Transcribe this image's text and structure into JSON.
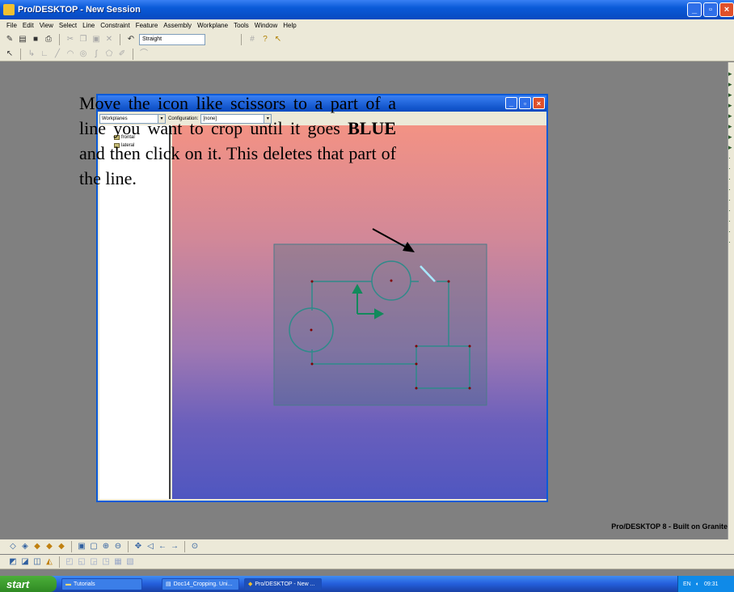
{
  "window": {
    "title": "Pro/DESKTOP - New Session"
  },
  "menu": [
    "File",
    "Edit",
    "View",
    "Select",
    "Line",
    "Constraint",
    "Feature",
    "Assembly",
    "Workplane",
    "Tools",
    "Window",
    "Help"
  ],
  "toolbar": {
    "line_style_value": "Straight"
  },
  "browser": {
    "workplanes_select": "Workplanes",
    "configuration_label": "Configuration:",
    "configuration_value": "[none]",
    "tree_items": [
      "frontal",
      "lateral"
    ]
  },
  "note": {
    "part1": "Move the icon like scissors to a part of a line you want to crop until it goes ",
    "bold": "BLUE",
    "part2": " and then click on it. This deletes that part of the line."
  },
  "status": {
    "product_label": "Pro/DESKTOP 8 - Built on Granite"
  },
  "taskbar": {
    "start_label": "start",
    "tasks": [
      "Tutorials",
      "Doc14_Cropping. Uni...",
      "Pro/DESKTOP - New ..."
    ],
    "tray_lang": "EN",
    "clock": "09:31"
  },
  "colors": {
    "sketch_line": "#2f8a8a",
    "selected_line": "#a8e8ff",
    "axis": "#128a5c"
  },
  "icons": {
    "toolbar": [
      "pencil-icon",
      "open-icon",
      "save-icon",
      "print-icon",
      "cut-icon",
      "copy-icon",
      "paste-icon",
      "delete-icon",
      "undo-icon",
      "grid-icon",
      "help-icon",
      "whats-this-icon"
    ]
  }
}
